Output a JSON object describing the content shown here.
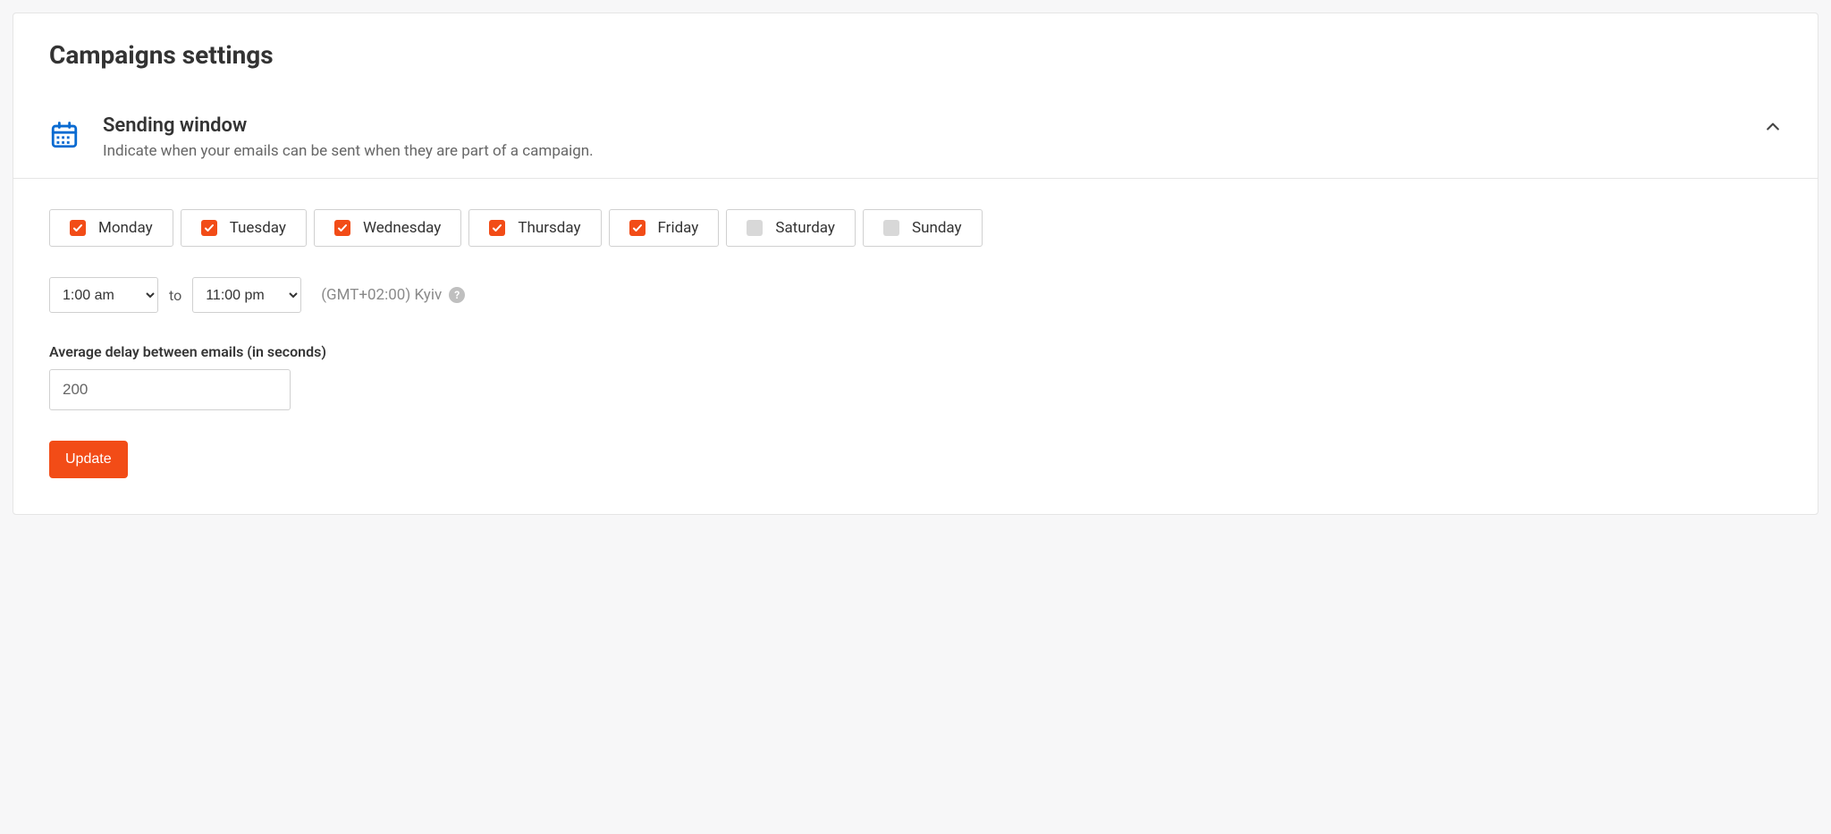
{
  "page": {
    "title": "Campaigns settings"
  },
  "section": {
    "title": "Sending window",
    "subtitle": "Indicate when your emails can be sent when they are part of a campaign."
  },
  "days": [
    {
      "label": "Monday",
      "checked": true
    },
    {
      "label": "Tuesday",
      "checked": true
    },
    {
      "label": "Wednesday",
      "checked": true
    },
    {
      "label": "Thursday",
      "checked": true
    },
    {
      "label": "Friday",
      "checked": true
    },
    {
      "label": "Saturday",
      "checked": false
    },
    {
      "label": "Sunday",
      "checked": false
    }
  ],
  "time": {
    "from": "1:00 am",
    "to_label": "to",
    "to": "11:00 pm",
    "timezone": "(GMT+02:00) Kyiv"
  },
  "delay": {
    "label": "Average delay between emails (in seconds)",
    "value": "200"
  },
  "actions": {
    "update": "Update"
  },
  "colors": {
    "accent": "#f24c17",
    "icon_blue": "#0a6bd1"
  }
}
